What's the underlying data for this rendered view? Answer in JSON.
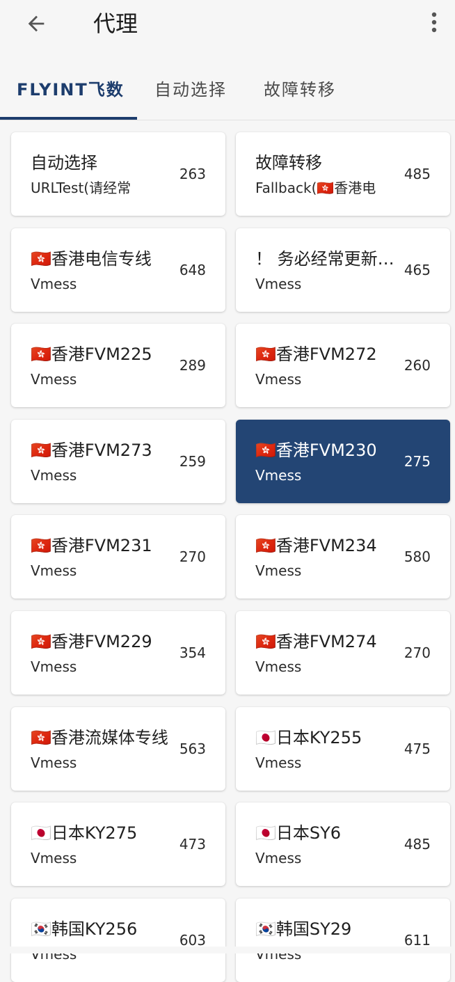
{
  "appbar": {
    "back_icon": "back-arrow-icon",
    "title": "代理",
    "more_icon": "more-vert-icon"
  },
  "tabs": [
    {
      "label": "FLYINT飞数",
      "active": true
    },
    {
      "label": "自动选择",
      "active": false
    },
    {
      "label": "故障转移",
      "active": false
    }
  ],
  "colors": {
    "accent": "#1d3d6d",
    "selected_card": "#234574",
    "background": "#f6f6f6"
  },
  "proxies": [
    {
      "name": "自动选择",
      "type": "URLTest(请经常",
      "delay": "263",
      "selected": false
    },
    {
      "name": "故障转移",
      "type": "Fallback(🇭🇰香港电",
      "delay": "485",
      "selected": false
    },
    {
      "name": "🇭🇰香港电信专线",
      "type": "Vmess",
      "delay": "648",
      "selected": false
    },
    {
      "name": "！ 务必经常更新订阅",
      "type": "Vmess",
      "delay": "465",
      "selected": false
    },
    {
      "name": "🇭🇰香港FVM225",
      "type": "Vmess",
      "delay": "289",
      "selected": false
    },
    {
      "name": "🇭🇰香港FVM272",
      "type": "Vmess",
      "delay": "260",
      "selected": false
    },
    {
      "name": "🇭🇰香港FVM273",
      "type": "Vmess",
      "delay": "259",
      "selected": false
    },
    {
      "name": "🇭🇰香港FVM230",
      "type": "Vmess",
      "delay": "275",
      "selected": true
    },
    {
      "name": "🇭🇰香港FVM231",
      "type": "Vmess",
      "delay": "270",
      "selected": false
    },
    {
      "name": "🇭🇰香港FVM234",
      "type": "Vmess",
      "delay": "580",
      "selected": false
    },
    {
      "name": "🇭🇰香港FVM229",
      "type": "Vmess",
      "delay": "354",
      "selected": false
    },
    {
      "name": "🇭🇰香港FVM274",
      "type": "Vmess",
      "delay": "270",
      "selected": false
    },
    {
      "name": "🇭🇰香港流媒体专线",
      "type": "Vmess",
      "delay": "563",
      "selected": false
    },
    {
      "name": "🇯🇵日本KY255",
      "type": "Vmess",
      "delay": "475",
      "selected": false
    },
    {
      "name": "🇯🇵日本KY275",
      "type": "Vmess",
      "delay": "473",
      "selected": false
    },
    {
      "name": "🇯🇵日本SY6",
      "type": "Vmess",
      "delay": "485",
      "selected": false
    },
    {
      "name": "🇰🇷韩国KY256",
      "type": "Vmess",
      "delay": "603",
      "selected": false
    },
    {
      "name": "🇰🇷韩国SY29",
      "type": "Vmess",
      "delay": "611",
      "selected": false
    }
  ]
}
